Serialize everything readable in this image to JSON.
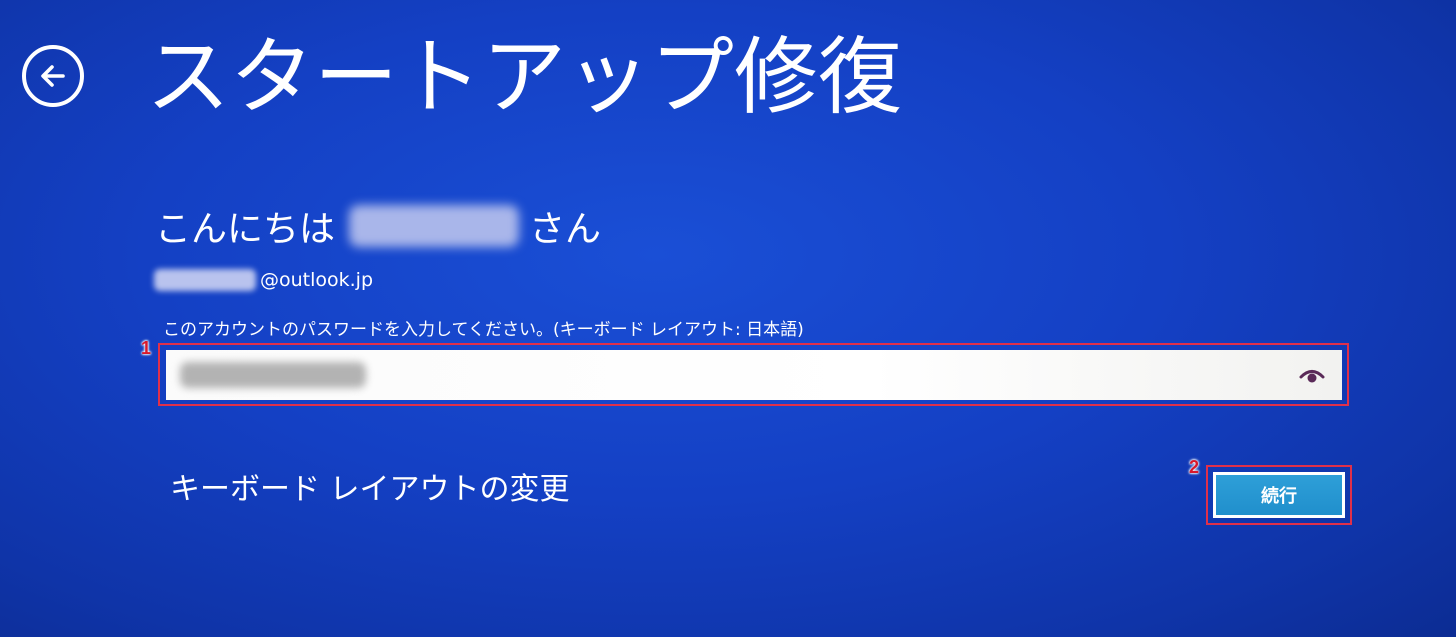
{
  "header": {
    "title": "スタートアップ修復",
    "back_icon": "back-arrow-icon"
  },
  "account": {
    "greeting_prefix": "こんにちは",
    "greeting_suffix": "さん",
    "email_domain": "@outlook.jp"
  },
  "password": {
    "prompt": "このアカウントのパスワードを入力してください。(キーボード レイアウト: 日本語)",
    "reveal_icon": "eye-icon"
  },
  "actions": {
    "keyboard_layout_link": "キーボード レイアウトの変更",
    "continue_label": "続行"
  },
  "annotations": {
    "step1": "1",
    "step2": "2",
    "highlight_color": "#e0304a",
    "number_color": "#d8192c"
  },
  "colors": {
    "background": "#1440c4",
    "button": "#208fcc"
  }
}
